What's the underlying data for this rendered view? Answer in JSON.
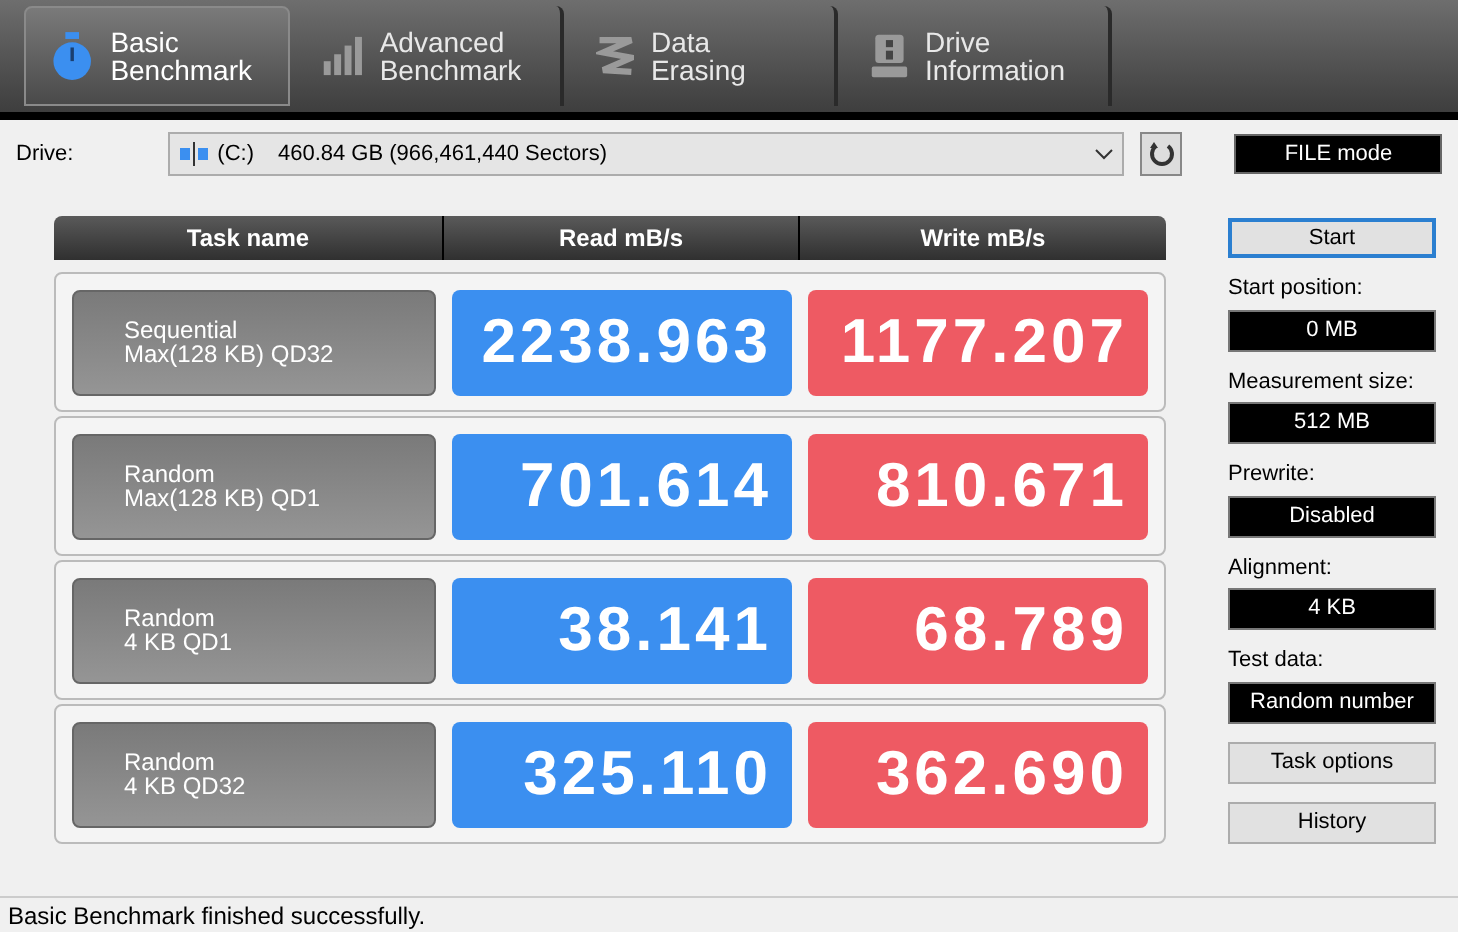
{
  "tabs": [
    {
      "label": "Basic Benchmark",
      "kind": "stopwatch",
      "selected": true
    },
    {
      "label": "Advanced Benchmark",
      "kind": "bars",
      "selected": false
    },
    {
      "label": "Data Erasing",
      "kind": "eraser",
      "selected": false
    },
    {
      "label": "Drive Information",
      "kind": "drive",
      "selected": false
    }
  ],
  "drive": {
    "label": "Drive:",
    "letter": "(C:)",
    "value": "460.84 GB (966,461,440 Sectors)"
  },
  "mode": "FILE mode",
  "table": {
    "columns": [
      "Task name",
      "Read mB/s",
      "Write mB/s"
    ],
    "rows": [
      {
        "task": [
          "Sequential",
          "Max(128 KB) QD32"
        ],
        "read": "2238.963",
        "write": "1177.207"
      },
      {
        "task": [
          "Random",
          "Max(128 KB) QD1"
        ],
        "read": "701.614",
        "write": "810.671"
      },
      {
        "task": [
          "Random",
          "4 KB QD1"
        ],
        "read": "38.141",
        "write": "68.789"
      },
      {
        "task": [
          "Random",
          "4 KB QD32"
        ],
        "read": "325.110",
        "write": "362.690"
      }
    ]
  },
  "start_button": "Start",
  "settings": [
    {
      "label": "Start position:",
      "value": "0 MB"
    },
    {
      "label": "Measurement size:",
      "value": "512 MB"
    },
    {
      "label": "Prewrite:",
      "value": "Disabled"
    },
    {
      "label": "Alignment:",
      "value": "4 KB"
    },
    {
      "label": "Test data:",
      "value": "Random number"
    }
  ],
  "buttons": [
    "Task options",
    "History"
  ],
  "status_bar": "Basic Benchmark finished successfully."
}
